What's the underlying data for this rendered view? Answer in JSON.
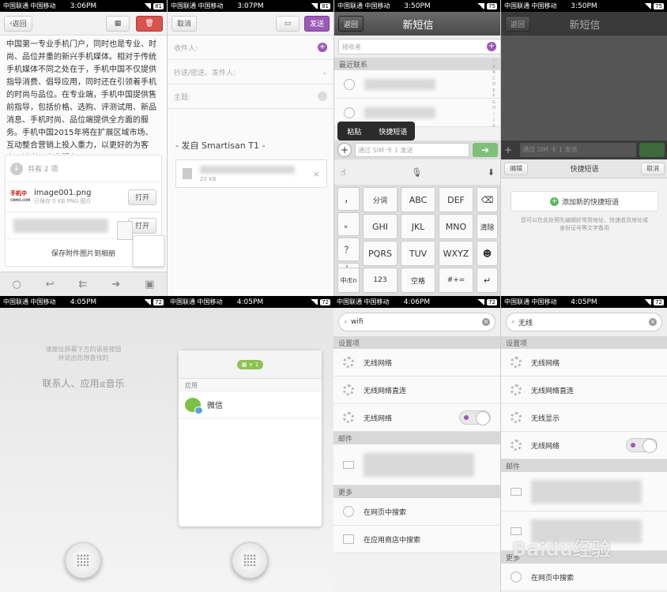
{
  "status_bars": [
    {
      "carrier": "中国联通 中国移动",
      "time": "3:06PM",
      "battery": "81"
    },
    {
      "carrier": "中国联通 中国移动",
      "time": "3:07PM",
      "battery": "81"
    },
    {
      "carrier": "中国联通 中国移动",
      "time": "3:50PM",
      "battery": "75"
    },
    {
      "carrier": "中国联通 中国移动",
      "time": "3:50PM",
      "battery": "75"
    },
    {
      "carrier": "中国联通 中国移动",
      "time": "4:05PM",
      "battery": "72"
    },
    {
      "carrier": "中国联通 中国移动",
      "time": "4:05PM",
      "battery": "72"
    },
    {
      "carrier": "中国联通 中国移动",
      "time": "4:06PM",
      "battery": "72"
    },
    {
      "carrier": "中国联通 中国移动",
      "time": "4:05PM",
      "battery": "72"
    }
  ],
  "email": {
    "back": "返回",
    "body": "中国第一专业手机门户，同时也是专业、时尚、品位并重的新兴手机媒体。相对于传统手机媒体不同之处在于，手机中国不仅提供指导消费、倡导应用，同时还在引领着手机的时尚与品位。在专业端，手机中国提供售前指导，包括价格、选购、评测试用、新品消息、手机时尚、品位端提供全方面的服务。手机中国2015年将在扩展区域市场、互动整合营销上投入重力，以更好的为客户、读者、产业服务!",
    "attach_count": "共有 2 项",
    "file_name": "image001.png",
    "file_meta": "已保存 0 KB PNG 图片",
    "file_logo": "手机中",
    "file_logo_sub": "CNMO.COM",
    "open": "打开",
    "open2": "打开",
    "save_all": "保存附件图片到相册"
  },
  "compose": {
    "cancel": "取消",
    "send": "发送",
    "to": "收件人:",
    "cc": "抄送/密送、发件人:",
    "subject": "主题:",
    "signature": "- 发自 Smartisan T1 -",
    "attach_size": "20 KB"
  },
  "sms": {
    "back": "返回",
    "title": "新短信",
    "recipient_ph": "接收者",
    "recent": "最近联系",
    "menu_paste": "粘贴",
    "menu_quick": "快捷短语",
    "input_ph": "通过 SIM 卡 1 发送",
    "index": [
      "☆",
      "A",
      "B",
      "C",
      "D",
      "E",
      "F",
      "G",
      "H",
      "I",
      "J",
      "K",
      "L",
      "M",
      "N",
      "O",
      "P",
      "Q",
      "R",
      "S",
      "T",
      "U",
      "V",
      "W",
      "X",
      "Y",
      "Z",
      "#"
    ],
    "keys_left": [
      "，",
      "。",
      "？",
      "！"
    ],
    "keys": [
      "分词",
      "ABC",
      "DEF",
      "GHI",
      "JKL",
      "MNO",
      "PQRS",
      "TUV",
      "WXYZ"
    ],
    "key_clear": "清除",
    "key_lang": "中/En",
    "key_num": "123",
    "key_space": "空格",
    "key_sym": "#+="
  },
  "quick": {
    "back": "返回",
    "title": "新短信",
    "input_ph": "通过 SIM 卡 1 发送",
    "edit": "编辑",
    "header": "快捷短语",
    "cancel": "取消",
    "add": "添加新的快捷短语",
    "hint": "您可以在此处预先编辑好常用地址、快速收货地址或身份证号等文字备用"
  },
  "voice": {
    "hint1": "请按住屏幕下方的语音按钮",
    "hint2": "并说出您想查找的",
    "targets": "联系人、应用",
    "or": "或",
    "music": "音乐"
  },
  "voice_result": {
    "badge": "× 1",
    "section": "应用",
    "app": "微信"
  },
  "search_wifi": {
    "query": "wifi",
    "sec_settings": "设置项",
    "items": [
      "无线网络",
      "无线网络直连",
      "无线网络"
    ],
    "sec_mail": "邮件",
    "sec_more": "更多",
    "more": [
      "在网页中搜索",
      "在应用商店中搜索"
    ]
  },
  "search_cn": {
    "query": "无线",
    "sec_settings": "设置项",
    "items": [
      "无线网络",
      "无线网络直连",
      "无线显示",
      "无线网络"
    ],
    "sec_mail": "邮件",
    "sec_more": "更多",
    "more": [
      "在网页中搜索"
    ]
  },
  "watermark": "Baidu经验"
}
